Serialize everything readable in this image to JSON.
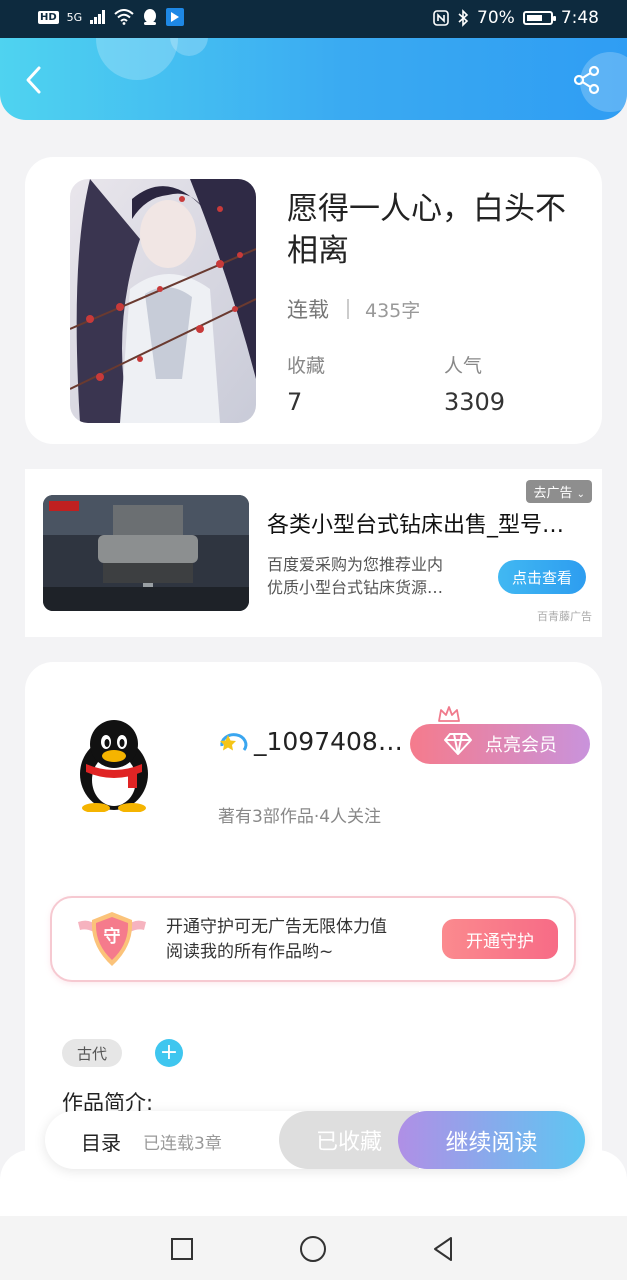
{
  "status_bar": {
    "hd": "HD",
    "network": "5G",
    "battery": "70%",
    "battery_level": 0.7,
    "time": "7:48"
  },
  "header": {
    "back_icon": "chevron-left-icon",
    "share_icon": "share-icon"
  },
  "book": {
    "title": "愿得一人心，白头不相离",
    "status": "连载",
    "word_count": "435字",
    "favorites_label": "收藏",
    "favorites_value": "7",
    "popularity_label": "人气",
    "popularity_value": "3309"
  },
  "ad": {
    "close_label": "去广告",
    "title": "各类小型台式钻床出售_型号齐全",
    "desc_line1": "百度爱采购为您推荐业内",
    "desc_line2": "优质小型台式钻床货源…",
    "button_label": "点击查看",
    "source": "百青藤广告"
  },
  "author": {
    "name": "_1097408…",
    "subtitle": "著有3部作品·4人关注",
    "vip_label": "点亮会员"
  },
  "guard": {
    "badge_text": "守",
    "line1": "开通守护可无广告无限体力值",
    "line2": "阅读我的所有作品哟~",
    "button_label": "开通守护"
  },
  "tags": {
    "items": [
      "古代"
    ],
    "add_label": "+"
  },
  "intro": {
    "label": "作品简介:"
  },
  "action_bar": {
    "toc_label": "目录",
    "toc_sub": "已连载3章",
    "collected_label": "已收藏",
    "read_label": "继续阅读"
  },
  "colors": {
    "header_start": "#4fd3f0",
    "header_end": "#2f9df3",
    "vip_start": "#f57b8c",
    "vip_end": "#c993dc",
    "read_start": "#b08fe6",
    "read_end": "#5ec6f2"
  }
}
